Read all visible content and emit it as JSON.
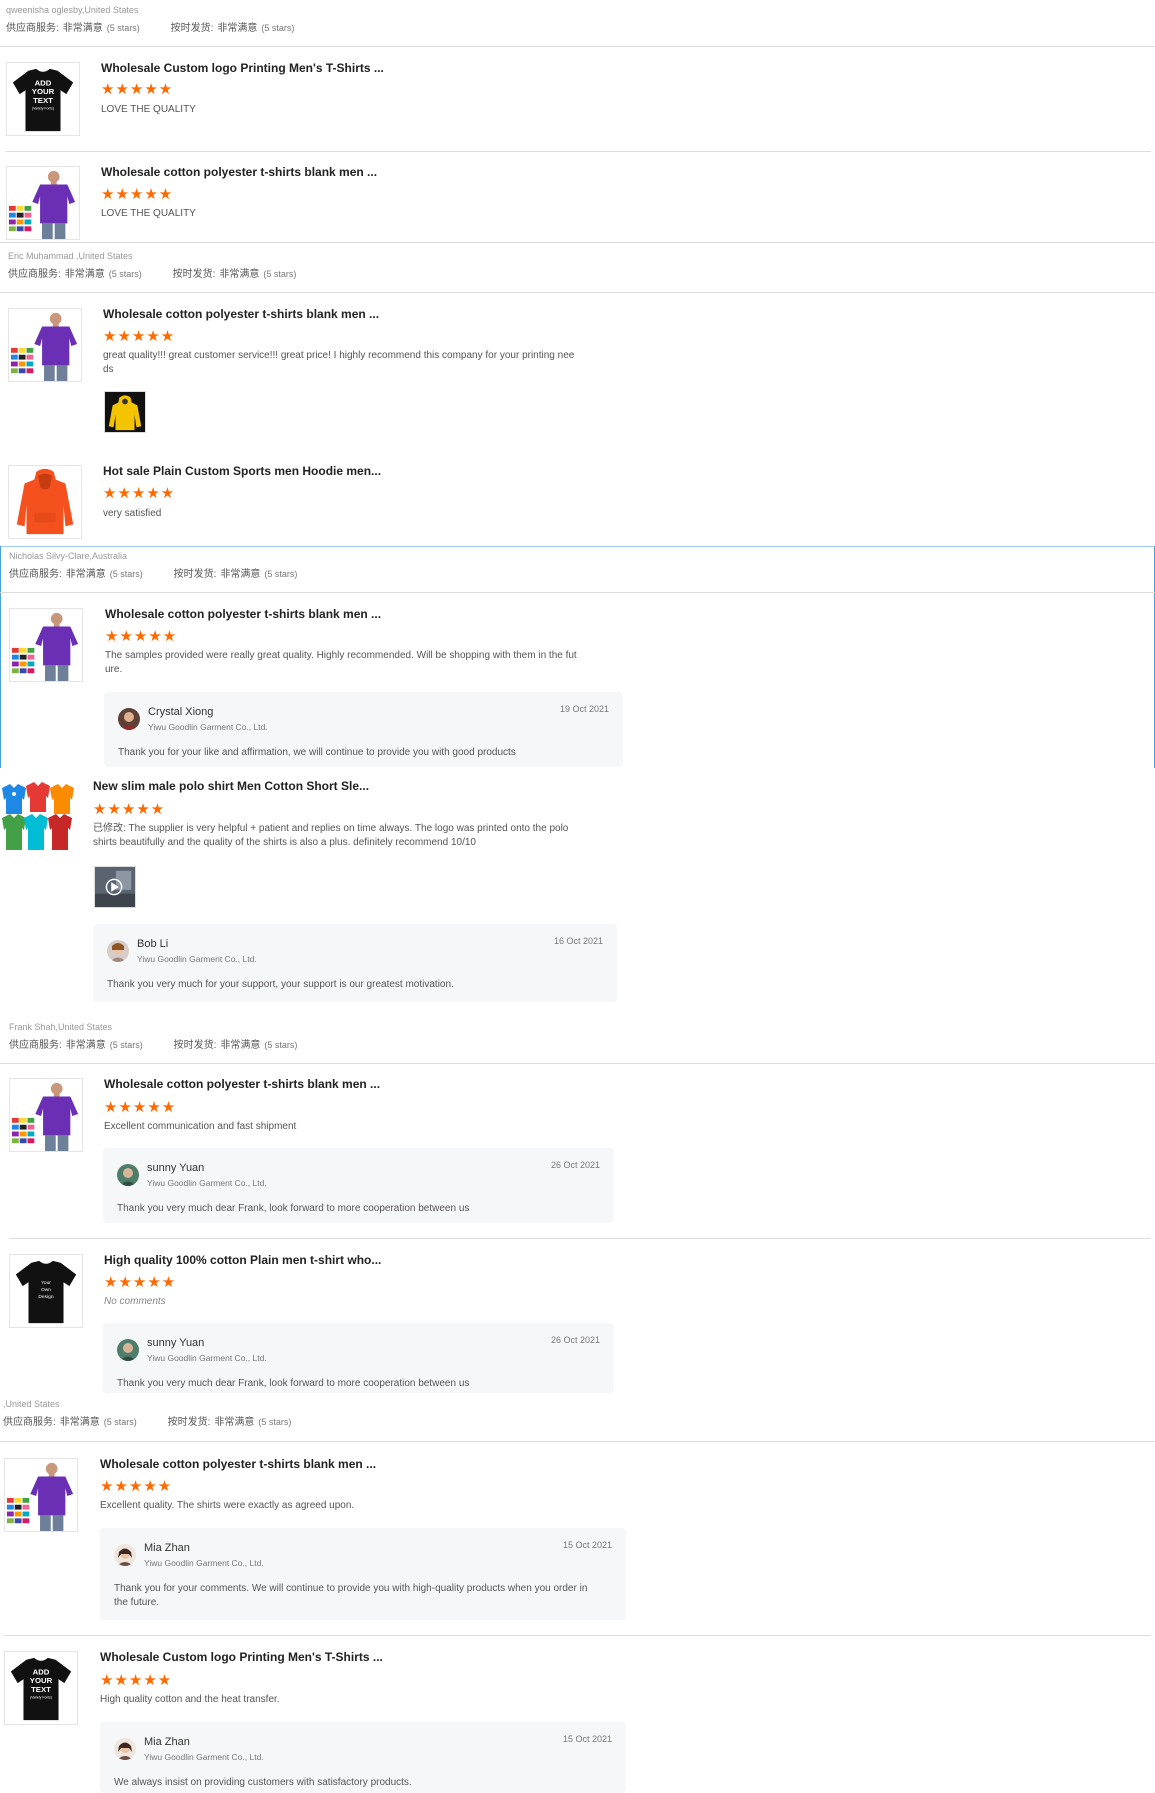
{
  "reviewers": [
    {
      "who": "qweenisha oglesby,United States",
      "svc_label": "供应商服务:",
      "svc_val": "非常满意",
      "svc_stars": "(5 stars)",
      "ship_label": "按时发货:",
      "ship_val": "非常满意",
      "ship_stars": "(5 stars)"
    },
    {
      "who": "Eric Muhammad ,United States",
      "svc_label": "供应商服务:",
      "svc_val": "非常满意",
      "svc_stars": "(5 stars)",
      "ship_label": "按时发货:",
      "ship_val": "非常满意",
      "ship_stars": "(5 stars)"
    },
    {
      "who": "Nicholas Silvy-Clare,Australia",
      "svc_label": "供应商服务:",
      "svc_val": "非常满意",
      "svc_stars": "(5 stars)",
      "ship_label": "按时发货:",
      "ship_val": "非常满意",
      "ship_stars": "(5 stars)"
    },
    {
      "who": "Frank Shah,United States",
      "svc_label": "供应商服务:",
      "svc_val": "非常满意",
      "svc_stars": "(5 stars)",
      "ship_label": "按时发货:",
      "ship_val": "非常满意",
      "ship_stars": "(5 stars)"
    },
    {
      "who": ",United States",
      "svc_label": "供应商服务:",
      "svc_val": "非常满意",
      "svc_stars": "(5 stars)",
      "ship_label": "按时发货:",
      "ship_val": "非常满意",
      "ship_stars": "(5 stars)"
    }
  ],
  "items": [
    {
      "title": "Wholesale Custom logo Printing Men's T-Shirts ...",
      "stars": "★★★★★",
      "text": "LOVE THE QUALITY",
      "thumb": "black-tshirt-add-text"
    },
    {
      "title": "Wholesale cotton polyester t-shirts blank men ...",
      "stars": "★★★★★",
      "text": "LOVE THE QUALITY",
      "thumb": "purple-tshirt-model"
    },
    {
      "title": "Wholesale cotton polyester t-shirts blank men ...",
      "stars": "★★★★★",
      "text1": "great quality!!! great customer service!!! great price! I highly recommend this company for your printing nee",
      "text2": "ds",
      "thumb": "purple-tshirt-model",
      "photo": "yellow-hoodie"
    },
    {
      "title": "Hot sale Plain Custom Sports men Hoodie men...",
      "stars": "★★★★★",
      "text": "very satisfied",
      "thumb": "orange-hoodie"
    },
    {
      "title": "Wholesale cotton polyester t-shirts blank men ...",
      "stars": "★★★★★",
      "text1": "The samples provided were really great quality. Highly recommended. Will be shopping with them in the fut",
      "text2": "ure.",
      "thumb": "purple-tshirt-model",
      "reply": {
        "name": "Crystal Xiong",
        "company": "Yiwu Goodlin Garment Co., Ltd.",
        "date": "19 Oct 2021",
        "msg": "Thank you for your like and affirmation, we will continue to provide you with good products"
      }
    },
    {
      "title": "New slim male polo shirt Men Cotton Short Sle...",
      "stars": "★★★★★",
      "text1": "已修改: The supplier is very helpful + patient and replies on time always. The logo was printed onto the polo",
      "text2": "shirts beautifully and the quality of the shirts is also a plus. definitely recommend 10/10",
      "thumb": "polo-shirts",
      "photo": "video-thumbnail",
      "reply": {
        "name": "Bob Li",
        "company": "Yiwu Goodlin Garment Co., Ltd.",
        "date": "16 Oct 2021",
        "msg": "Thank you very much for your support, your support is our greatest motivation."
      }
    },
    {
      "title": "Wholesale cotton polyester t-shirts blank men ...",
      "stars": "★★★★★",
      "text": "Excellent communication and fast shipment",
      "thumb": "purple-tshirt-model",
      "reply": {
        "name": "sunny Yuan",
        "company": "Yiwu Goodlin Garment Co., Ltd.",
        "date": "26 Oct 2021",
        "msg": "Thank you very much dear Frank, look forward to more cooperation between us"
      }
    },
    {
      "title": "High quality 100% cotton Plain men t-shirt who...",
      "stars": "★★★★★",
      "text": "No comments",
      "thumb": "black-tshirt-your-design",
      "reply": {
        "name": "sunny Yuan",
        "company": "Yiwu Goodlin Garment Co., Ltd.",
        "date": "26 Oct 2021",
        "msg": "Thank you very much dear Frank, look forward to more cooperation between us"
      }
    },
    {
      "title": "Wholesale cotton polyester t-shirts blank men ...",
      "stars": "★★★★★",
      "text": "Excellent quality. The shirts were exactly as agreed upon.",
      "thumb": "purple-tshirt-model",
      "reply": {
        "name": "Mia Zhan",
        "company": "Yiwu Goodlin Garment Co., Ltd.",
        "date": "15 Oct 2021",
        "msg1": "Thank you for your comments. We will continue to provide you with high-quality products when you order in",
        "msg2": "the future."
      }
    },
    {
      "title": "Wholesale Custom logo Printing Men's T-Shirts ...",
      "stars": "★★★★★",
      "text": "High quality cotton and the heat transfer.",
      "thumb": "black-tshirt-add-text",
      "reply": {
        "name": "Mia Zhan",
        "company": "Yiwu Goodlin Garment Co., Ltd.",
        "date": "15 Oct 2021",
        "msg": "We always insist on providing customers with satisfactory products."
      }
    }
  ],
  "thumb_text": {
    "add_your_text": [
      "ADD",
      "YOUR",
      "TEXT",
      "(Variety Fonts)"
    ],
    "your_own_design": [
      "Your",
      "Own",
      "Design"
    ]
  },
  "colors": {
    "star": "#ff6a00",
    "divider": "#dcdcdc",
    "reply_bg": "#f6f7f9",
    "highlight": "#4aa3df"
  }
}
